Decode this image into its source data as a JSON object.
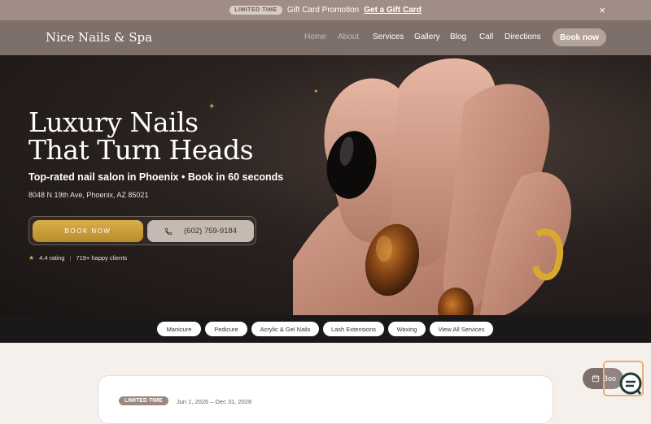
{
  "promo": {
    "tag": "LIMITED TIME",
    "text": "Gift Card Promotion",
    "link": "Get a Gift Card",
    "close": "×"
  },
  "nav": {
    "brand": "Nice Nails & Spa",
    "links": [
      "Home",
      "About",
      "Services",
      "Gallery",
      "Blog",
      "Call",
      "Directions"
    ],
    "book": "Book now"
  },
  "hero": {
    "title_line1": "Luxury Nails",
    "title_line2": "That Turn Heads",
    "subtitle": "Top-rated nail salon in Phoenix • Book in 60 seconds",
    "address": "8048 N 19th Ave, Phoenix, AZ 85021",
    "cta_book": "BOOK NOW",
    "cta_phone": "(602) 759-9184",
    "rating": "4.4 rating",
    "separator": "|",
    "clients": "719+ happy clients"
  },
  "services": [
    "Manicure",
    "Pedicure",
    "Acrylic & Gel Nails",
    "Lash Extensions",
    "Waxing",
    "View All Services"
  ],
  "offer": {
    "tag": "LIMITED TIME",
    "date": "Jun 1, 2026 – Dec 31, 2028"
  },
  "float_book": "Boo",
  "colors": {
    "promo_bar": "#a08e86",
    "nav": "#7d706a",
    "gold": "#d9b04a",
    "services_strip": "#1a1818"
  }
}
